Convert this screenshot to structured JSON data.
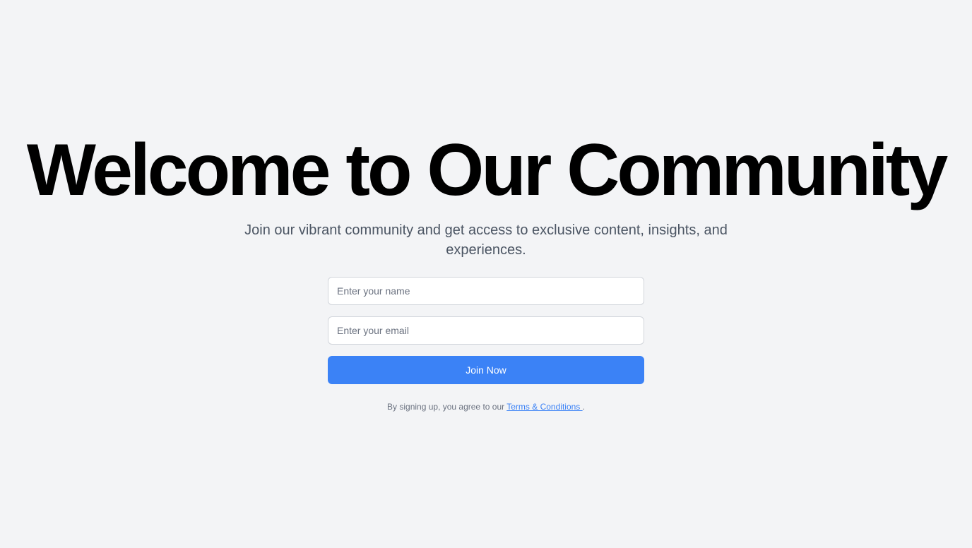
{
  "hero": {
    "title": "Welcome to Our Community",
    "subtitle": "Join our vibrant community and get access to exclusive content, insights, and experiences."
  },
  "form": {
    "name_placeholder": "Enter your name",
    "name_value": "",
    "email_placeholder": "Enter your email",
    "email_value": "",
    "submit_label": "Join Now"
  },
  "legal": {
    "prefix": "By signing up, you agree to our",
    "link_label": "Terms & Conditions ",
    "suffix": "."
  },
  "colors": {
    "background": "#f3f4f6",
    "accent": "#3b82f6",
    "title": "#000000",
    "muted_text": "#4b5563"
  }
}
